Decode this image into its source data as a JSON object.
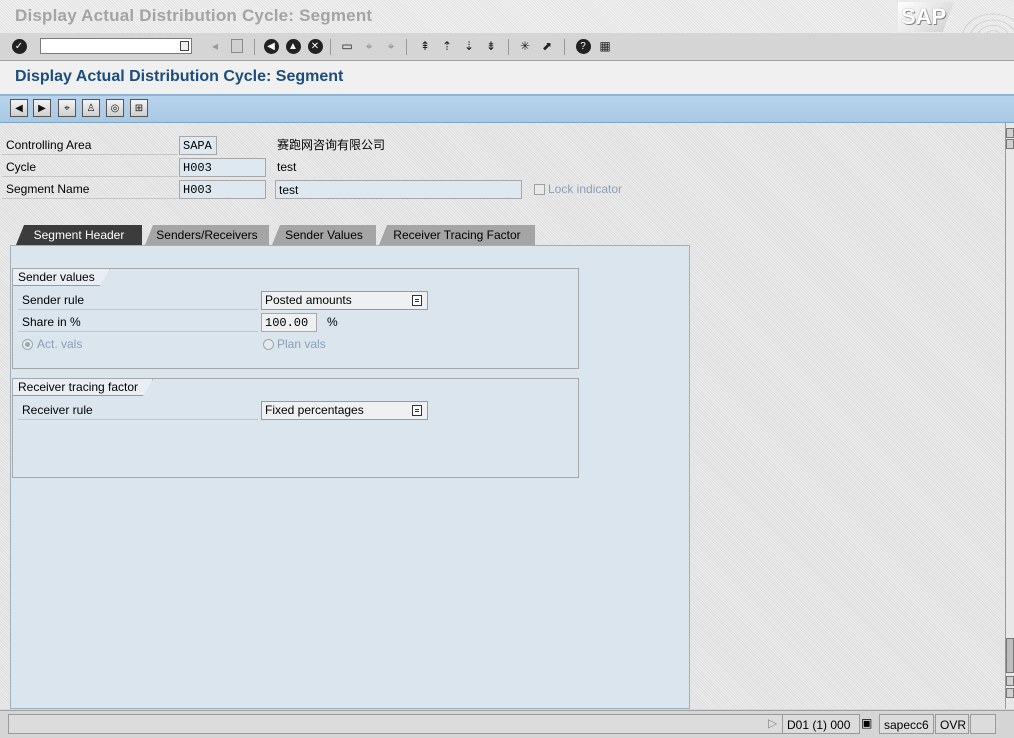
{
  "window": {
    "title": "Display Actual Distribution Cycle: Segment",
    "logo_text": "SAP"
  },
  "screen": {
    "title": "Display Actual Distribution Cycle: Segment"
  },
  "header": {
    "controlling_area": {
      "label": "Controlling Area",
      "value": "SAPA",
      "description": "赛跑网咨询有限公司"
    },
    "cycle": {
      "label": "Cycle",
      "value": "H003",
      "description": "test"
    },
    "segment_name": {
      "label": "Segment Name",
      "value": "H003",
      "description": "test"
    },
    "lock_indicator": {
      "label": "Lock indicator",
      "checked": false
    }
  },
  "tabs": [
    {
      "label": "Segment Header",
      "active": true
    },
    {
      "label": "Senders/Receivers",
      "active": false
    },
    {
      "label": "Sender Values",
      "active": false
    },
    {
      "label": "Receiver Tracing Factor",
      "active": false
    }
  ],
  "sender_values": {
    "title": "Sender values",
    "sender_rule": {
      "label": "Sender rule",
      "value": "Posted amounts"
    },
    "share": {
      "label": "Share in %",
      "value": "100.00",
      "unit": "%"
    },
    "act_vals": {
      "label": "Act. vals",
      "selected": true
    },
    "plan_vals": {
      "label": "Plan vals",
      "selected": false
    }
  },
  "receiver_tracing": {
    "title": "Receiver tracing factor",
    "receiver_rule": {
      "label": "Receiver rule",
      "value": "Fixed percentages"
    }
  },
  "status": {
    "session": "D01 (1) 000",
    "server": "sapecc6",
    "mode": "OVR"
  }
}
